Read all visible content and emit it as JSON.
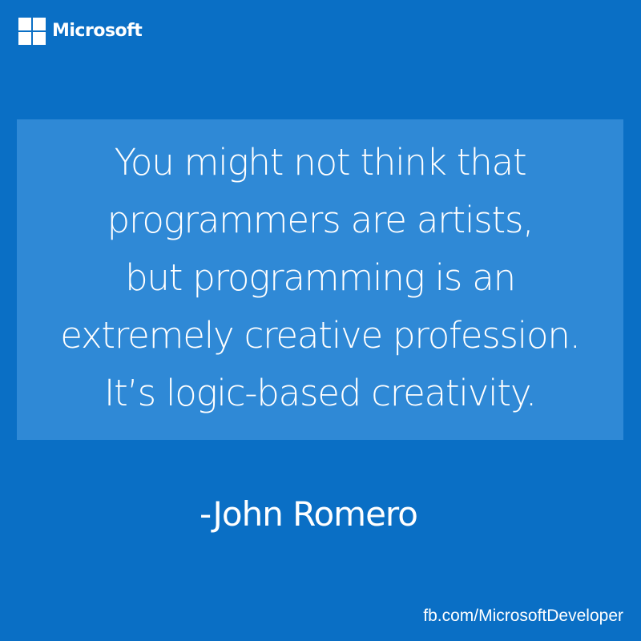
{
  "brand": {
    "name": "Microsoft",
    "logo_icon": "windows-logo-icon"
  },
  "quote": {
    "lines": [
      "You might not think that",
      "programmers are artists,",
      "but programming is an",
      "extremely creative profession.",
      "It’s logic-based creativity."
    ],
    "author": "-John Romero"
  },
  "footer": {
    "link_text": "fb.com/MicrosoftDeveloper"
  },
  "colors": {
    "background": "#0a6fc5",
    "quote_panel": "#2f89d6",
    "text": "#ffffff"
  }
}
